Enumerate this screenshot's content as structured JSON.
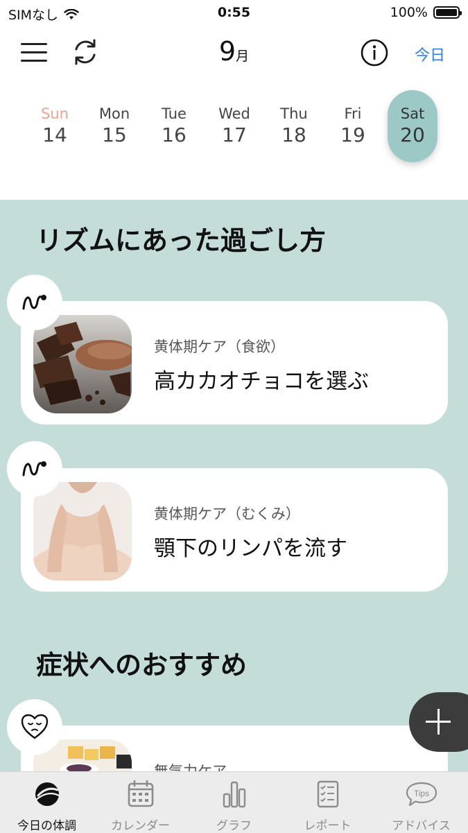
{
  "status_bar": {
    "carrier": "SIMなし",
    "time": "0:55",
    "battery": "100%"
  },
  "header": {
    "month_number": "9",
    "month_unit": "月",
    "today_label": "今日",
    "icons": [
      "menu-icon",
      "refresh-icon",
      "info-icon"
    ]
  },
  "week": {
    "days": [
      {
        "name": "Sun",
        "date": "14"
      },
      {
        "name": "Mon",
        "date": "15"
      },
      {
        "name": "Tue",
        "date": "16"
      },
      {
        "name": "Wed",
        "date": "17"
      },
      {
        "name": "Thu",
        "date": "18"
      },
      {
        "name": "Fri",
        "date": "19"
      },
      {
        "name": "Sat",
        "date": "20"
      }
    ],
    "selected": "Sat"
  },
  "sections": {
    "rhythm_title": "リズムにあった過ごし方",
    "symptom_title": "症状へのおすすめ"
  },
  "cards": [
    {
      "category": "黄体期ケア（食欲）",
      "title": "高カカオチョコを選ぶ"
    },
    {
      "category": "黄体期ケア（むくみ）",
      "title": "顎下のリンパを流す"
    },
    {
      "category": "無気力ケア",
      "title": ""
    }
  ],
  "tabbar": {
    "tabs": [
      {
        "label": "今日の体調",
        "icon": "today-icon"
      },
      {
        "label": "カレンダー",
        "icon": "calendar-icon"
      },
      {
        "label": "グラフ",
        "icon": "graph-icon"
      },
      {
        "label": "レポート",
        "icon": "report-icon"
      },
      {
        "label": "アドバイス",
        "icon": "tips-icon"
      }
    ],
    "active": "今日の体調",
    "tips_icon_text": "Tips"
  },
  "colors": {
    "accent_blue": "#2f7de1",
    "panel_teal": "#c4ddd9",
    "selected_day": "#9cc9c5",
    "sunday": "#e8a590",
    "fab": "#3c3c3c"
  }
}
